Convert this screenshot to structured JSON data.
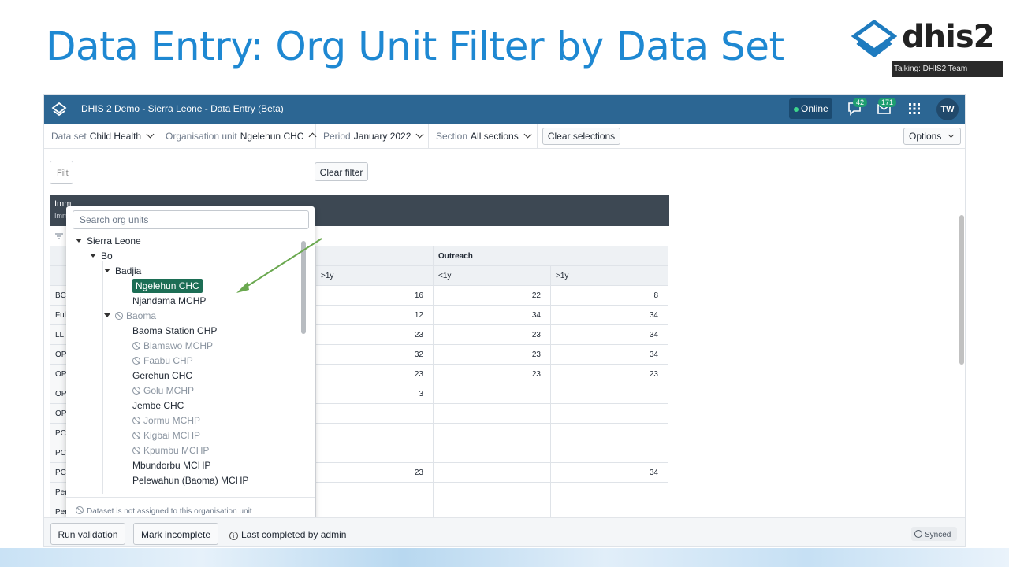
{
  "slide": {
    "title": "Data Entry: Org Unit Filter by Data Set",
    "logo_text": "dhis2",
    "talking_label": "Talking: DHIS2 Team"
  },
  "header": {
    "app_title": "DHIS 2 Demo - Sierra Leone - Data Entry (Beta)",
    "online_label": "Online",
    "messages_count": "42",
    "interpretations_count": "171",
    "avatar_initials": "TW"
  },
  "filters": {
    "dataset_label": "Data set",
    "dataset_value": "Child Health",
    "orgunit_label": "Organisation unit",
    "orgunit_value": "Ngelehun CHC",
    "period_label": "Period",
    "period_value": "January 2022",
    "section_label": "Section",
    "section_value": "All sections",
    "clear_selections": "Clear selections",
    "options": "Options"
  },
  "main": {
    "filter_placeholder": "Filt",
    "clear_filter": "Clear filter",
    "section_title": "Imm",
    "section_subtitle": "Imm"
  },
  "table": {
    "outreach_header": "Outreach",
    "sub_headers": [
      ">1y",
      "<1y",
      ">1y"
    ],
    "rows": [
      {
        "name": "BC",
        "c1": "16",
        "c2": "22",
        "c3": "8"
      },
      {
        "name": "Full",
        "c1": "12",
        "c2": "34",
        "c3": "34"
      },
      {
        "name": "LLI",
        "c1": "23",
        "c2": "23",
        "c3": "34"
      },
      {
        "name": "OP",
        "c1": "32",
        "c2": "23",
        "c3": "34"
      },
      {
        "name": "OP",
        "c1": "23",
        "c2": "23",
        "c3": "23"
      },
      {
        "name": "OP",
        "c1": "3",
        "c2": "",
        "c3": ""
      },
      {
        "name": "OP",
        "c1": "",
        "c2": "",
        "c3": ""
      },
      {
        "name": "PCV",
        "c1": "",
        "c2": "",
        "c3": ""
      },
      {
        "name": "PCV",
        "c1": "",
        "c2": "",
        "c3": ""
      },
      {
        "name": "PCV3 doses given",
        "c1": "23",
        "c2": "",
        "c3": "34"
      },
      {
        "name": "Penta1 doses given",
        "c1": "",
        "c2": "",
        "c3": ""
      },
      {
        "name": "Penta2 doses given",
        "c1": "",
        "c2": "",
        "c3": ""
      }
    ]
  },
  "orgunit_dropdown": {
    "search_placeholder": "Search org units",
    "tree": [
      {
        "label": "Sierra Leone",
        "expanded": true,
        "disabled": false
      },
      {
        "label": "Bo",
        "expanded": true,
        "disabled": false
      },
      {
        "label": "Badjia",
        "expanded": true,
        "disabled": false
      },
      {
        "label": "Ngelehun CHC",
        "selected": true,
        "disabled": false
      },
      {
        "label": "Njandama MCHP",
        "disabled": false
      },
      {
        "label": "Baoma",
        "expanded": true,
        "disabled": true
      },
      {
        "label": "Baoma Station CHP",
        "disabled": false
      },
      {
        "label": "Blamawo MCHP",
        "disabled": true
      },
      {
        "label": "Faabu CHP",
        "disabled": true
      },
      {
        "label": "Gerehun CHC",
        "disabled": false
      },
      {
        "label": "Golu MCHP",
        "disabled": true
      },
      {
        "label": "Jembe CHC",
        "disabled": false
      },
      {
        "label": "Jormu MCHP",
        "disabled": true
      },
      {
        "label": "Kigbai MCHP",
        "disabled": true
      },
      {
        "label": "Kpumbu MCHP",
        "disabled": true
      },
      {
        "label": "Mbundorbu MCHP",
        "disabled": false
      },
      {
        "label": "Pelewahun (Baoma) MCHP",
        "disabled": false
      }
    ],
    "footer_note": "Dataset is not assigned to this organisation unit"
  },
  "bottombar": {
    "run_validation": "Run validation",
    "mark_incomplete": "Mark incomplete",
    "last_completed": "Last completed by admin",
    "synced": "Synced"
  },
  "colors": {
    "header_blue": "#2c6693",
    "title_blue": "#1e88d2",
    "selected_green": "#1c6e55",
    "arrow_green": "#6aa84f"
  }
}
